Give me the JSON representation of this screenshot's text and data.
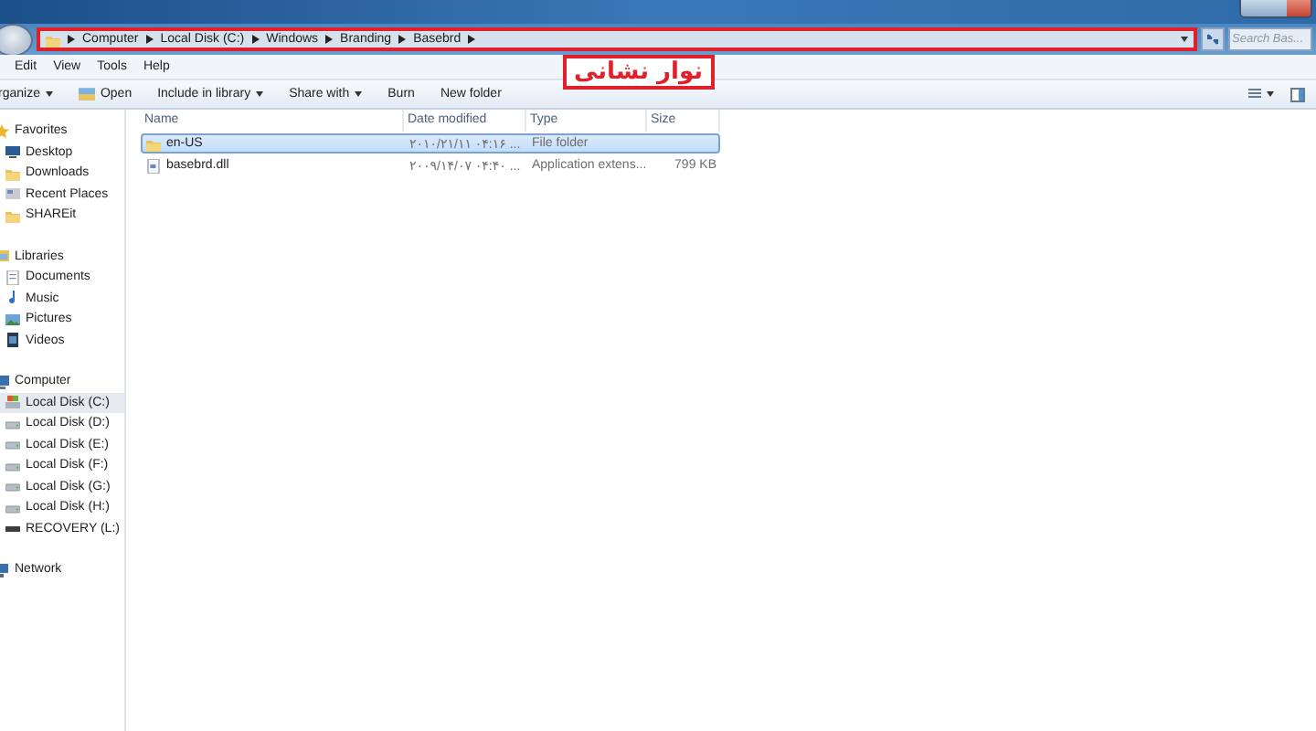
{
  "address_bar": {
    "crumbs": [
      "Computer",
      "Local Disk (C:)",
      "Windows",
      "Branding",
      "Basebrd"
    ],
    "annotation": "نوار نشانی"
  },
  "search": {
    "placeholder": "Search Bas..."
  },
  "menu": [
    "Edit",
    "View",
    "Tools",
    "Help"
  ],
  "toolbar": [
    {
      "label": "rganize",
      "kind": "dropdown"
    },
    {
      "label": "Open",
      "kind": "open"
    },
    {
      "label": "Include in library",
      "kind": "dropdown"
    },
    {
      "label": "Share with",
      "kind": "dropdown"
    },
    {
      "label": "Burn",
      "kind": "plain"
    },
    {
      "label": "New folder",
      "kind": "plain"
    }
  ],
  "sidebar": [
    {
      "label": "Favorites",
      "kind": "star",
      "items": [
        {
          "label": "Desktop",
          "kind": "desktop",
          "selected": false
        },
        {
          "label": "Downloads",
          "kind": "folder",
          "selected": false
        },
        {
          "label": "Recent Places",
          "kind": "recent",
          "selected": false
        },
        {
          "label": "SHAREit",
          "kind": "folder",
          "selected": false
        }
      ]
    },
    {
      "label": "Libraries",
      "kind": "library",
      "items": [
        {
          "label": "Documents",
          "kind": "document",
          "selected": false
        },
        {
          "label": "Music",
          "kind": "music",
          "selected": false
        },
        {
          "label": "Pictures",
          "kind": "picture",
          "selected": false
        },
        {
          "label": "Videos",
          "kind": "video",
          "selected": false
        }
      ]
    },
    {
      "label": "Computer",
      "kind": "computer",
      "items": [
        {
          "label": "Local Disk (C:)",
          "kind": "system",
          "selected": true
        },
        {
          "label": "Local Disk (D:)",
          "kind": "drive",
          "selected": false
        },
        {
          "label": "Local Disk (E:)",
          "kind": "drive",
          "selected": false
        },
        {
          "label": "Local Disk (F:)",
          "kind": "drive",
          "selected": false
        },
        {
          "label": "Local Disk (G:)",
          "kind": "drive",
          "selected": false
        },
        {
          "label": "Local Disk (H:)",
          "kind": "drive",
          "selected": false
        },
        {
          "label": "RECOVERY (L:)",
          "kind": "recovery",
          "selected": false
        }
      ]
    },
    {
      "label": "Network",
      "kind": "network"
    }
  ],
  "table": {
    "columns": [
      "Name",
      "Date modified",
      "Type",
      "Size"
    ],
    "rows": [
      {
        "name": "en-US",
        "date": "۲۰۱۰/۲۱/۱۱ ۰۴:۱۶ ...",
        "type": "File folder",
        "kind": "folder",
        "selected": true
      },
      {
        "name": "basebrd.dll",
        "date": "۲۰۰۹/۱۴/۰۷ ۰۴:۴۰ ...",
        "type": "Application extens...",
        "size": "799 KB",
        "kind": "file",
        "selected": false
      }
    ]
  }
}
